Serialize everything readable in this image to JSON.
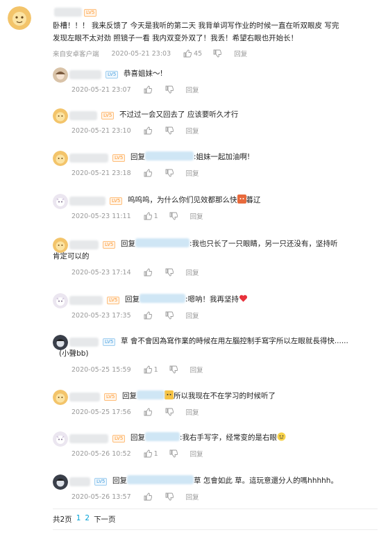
{
  "main": {
    "lv_label": "LV5",
    "text": "卧槽！！！ 我来反馈了 今天是我听的第二天 我背单词写作业的时候一直在听双眼皮 写完发现左眼不太对劲 照镜子一看 我内双变外双了！我丢！希望右眼也开始长！",
    "line1": "卧槽！！！ 我来反馈了 今天是我听的第二天 我背单词写作业的时候一直在听双眼皮 写完",
    "line2": "发现左眼不太对劲 照镜子一看 我内双变外双了！我丢！希望右眼也开始长！",
    "source": "来自安卓客户端",
    "time": "2020-05-21 23:03",
    "likes": "45",
    "reply": "回复"
  },
  "replies": [
    {
      "text": "恭喜姐妹～!",
      "time": "2020-05-21 23:07",
      "likes": "",
      "reply": "回复",
      "lv": "LV5"
    },
    {
      "text": "不过过一会又回去了 应该要听久才行",
      "time": "2020-05-21 23:10",
      "likes": "",
      "reply": "回复",
      "lv": "LV5"
    },
    {
      "prefix": "回复",
      "text": ":姐妹一起加油啊!",
      "time": "2020-05-21 23:18",
      "likes": "",
      "reply": "回复",
      "lv": "LV5"
    },
    {
      "text": "呜呜呜，为什么你们见效都那么快",
      "suffix": "暮辽",
      "time": "2020-05-23 11:11",
      "likes": "1",
      "reply": "回复",
      "lv": "LV5"
    },
    {
      "prefix": "回复",
      "text": ":我也只长了一只眼睛，另一只还没有，坚持听",
      "text2": "肯定可以的",
      "time": "2020-05-23 17:14",
      "likes": "",
      "reply": "回复",
      "lv": "LV5"
    },
    {
      "prefix": "回复",
      "text": ":嗯呐！我再坚持",
      "time": "2020-05-23 17:35",
      "likes": "",
      "reply": "回复",
      "lv": "LV5"
    },
    {
      "text": "草  會不會因為寫作業的時候在用左腦控制手寫字所以左眼就長得快......",
      "text2": "(小聲bb)",
      "time": "2020-05-25 15:59",
      "likes": "1",
      "reply": "回复",
      "lv": "LV5"
    },
    {
      "prefix": "回复",
      "text": "所以我现在不在学习的时候听了",
      "time": "2020-05-25 17:56",
      "likes": "",
      "reply": "回复",
      "lv": "LV5"
    },
    {
      "prefix": "回复",
      "text": ":我右手写字，经常变的是右眼",
      "time": "2020-05-26 10:52",
      "likes": "1",
      "reply": "回复",
      "lv": "LV5"
    },
    {
      "prefix": "回复",
      "text": "草  怎會如此  草。這玩意還分人的嗎hhhhh。",
      "time": "2020-05-26 13:57",
      "likes": "",
      "reply": "回复",
      "lv": "LV5"
    }
  ],
  "pager": {
    "total": "共2页",
    "p1": "1",
    "p2": "2",
    "next": "下一页"
  }
}
